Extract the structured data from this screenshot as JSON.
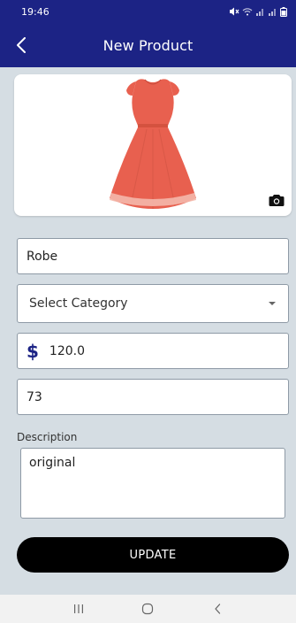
{
  "status_bar": {
    "time": "19:46",
    "icons": [
      "mute-icon",
      "wifi-icon",
      "signal-icon",
      "signal-icon",
      "battery-icon"
    ]
  },
  "app_bar": {
    "title": "New Product",
    "back_icon": "arrow-left-icon"
  },
  "product_image": {
    "camera_icon": "camera-icon"
  },
  "form": {
    "name_value": "Robe",
    "category_value": "Select Category",
    "price_symbol": "$",
    "price_value": "120.0",
    "quantity_value": "73",
    "description_label": "Description",
    "description_value": "original"
  },
  "actions": {
    "update_label": "UPDATE"
  },
  "nav_bar": {
    "icons": [
      "recent-apps-icon",
      "home-icon",
      "back-icon"
    ]
  },
  "colors": {
    "primary": "#1c2385",
    "background": "#d5dde3",
    "button": "#000000",
    "dress": "#e8604f"
  }
}
